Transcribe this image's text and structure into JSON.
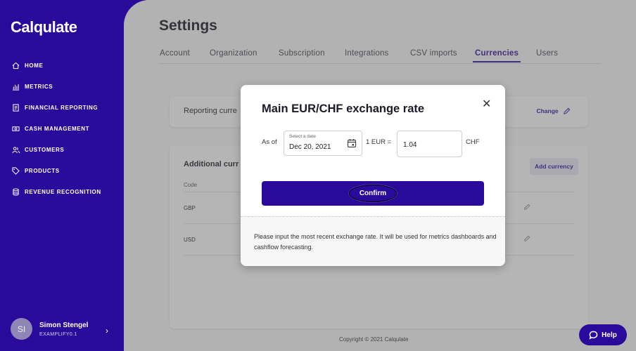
{
  "app": {
    "logo": "Calqulate"
  },
  "sidebar": {
    "items": [
      {
        "label": "HOME",
        "icon": "home-icon"
      },
      {
        "label": "METRICS",
        "icon": "bar-chart-icon"
      },
      {
        "label": "FINANCIAL REPORTING",
        "icon": "document-icon"
      },
      {
        "label": "CASH MANAGEMENT",
        "icon": "cash-icon"
      },
      {
        "label": "CUSTOMERS",
        "icon": "users-icon"
      },
      {
        "label": "PRODUCTS",
        "icon": "tag-icon"
      },
      {
        "label": "REVENUE RECOGNITION",
        "icon": "coins-icon"
      }
    ],
    "user": {
      "initials": "SI",
      "name": "Simon Stengel",
      "org": "EXAMPLIFY0.1"
    }
  },
  "page": {
    "title": "Settings",
    "tabs": [
      "Account",
      "Organization",
      "Subscription",
      "Integrations",
      "CSV imports",
      "Currencies",
      "Users"
    ],
    "active_tab": "Currencies"
  },
  "reporting": {
    "label": "Reporting curre",
    "change": "Change"
  },
  "additional": {
    "title": "Additional curr",
    "add_button": "Add currency",
    "code_header": "Code",
    "rows": [
      {
        "code": "GBP"
      },
      {
        "code": "USD"
      }
    ]
  },
  "modal": {
    "title": "Main EUR/CHF exchange rate",
    "as_of": "As of",
    "date_label": "Select a date",
    "date_value": "Dec 20, 2021",
    "eur_label": "1 EUR =",
    "rate_value": "1.04",
    "chf_label": "CHF",
    "confirm": "Confirm",
    "note": "Please input the most recent exchange rate. It will be used for metrics dashboards and cashflow forecasting."
  },
  "footer": "Copyright © 2021 Calqulate",
  "help": "Help",
  "colors": {
    "brand": "#2a0a9a",
    "accent_light": "#ece9f8"
  }
}
